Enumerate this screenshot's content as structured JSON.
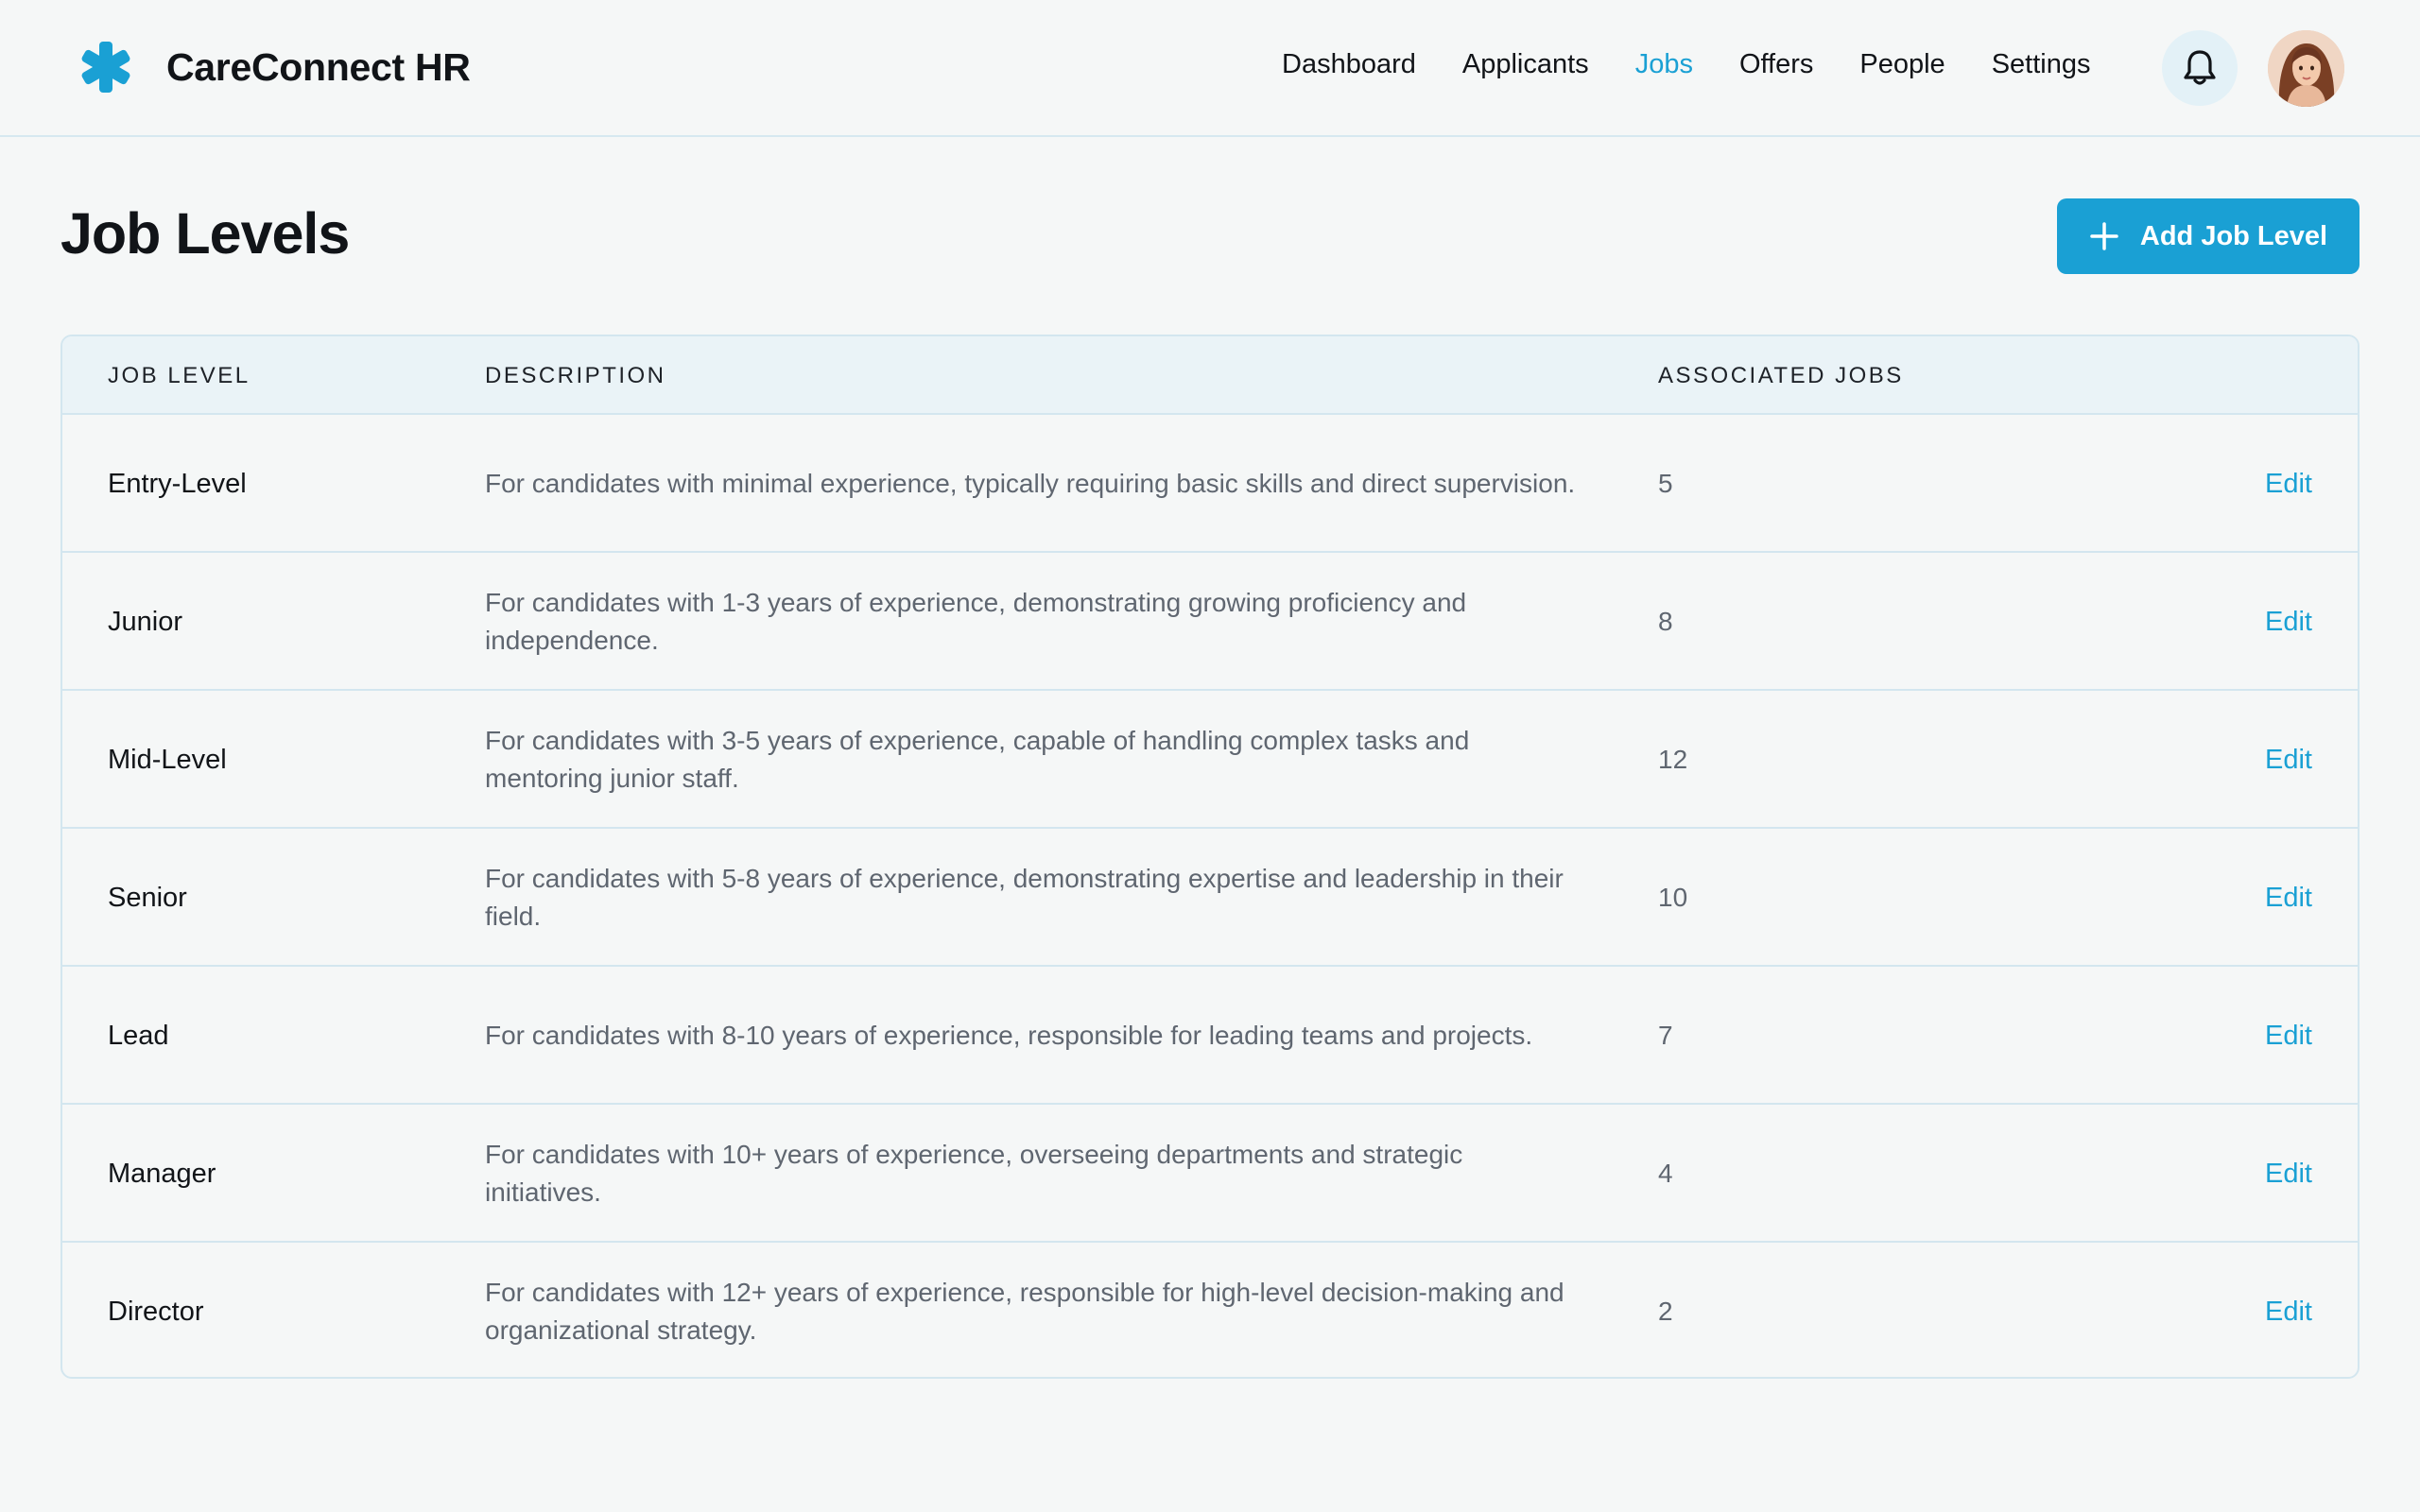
{
  "app": {
    "name": "CareConnect HR",
    "logo_icon": "asterisk-icon",
    "accent_color": "#1aa0d4"
  },
  "nav": {
    "items": [
      {
        "label": "Dashboard",
        "active": false
      },
      {
        "label": "Applicants",
        "active": false
      },
      {
        "label": "Jobs",
        "active": true
      },
      {
        "label": "Offers",
        "active": false
      },
      {
        "label": "People",
        "active": false
      },
      {
        "label": "Settings",
        "active": false
      }
    ],
    "notification_icon": "bell-icon",
    "avatar_icon": "user-avatar"
  },
  "page": {
    "title": "Job Levels",
    "add_button_label": "Add Job Level",
    "add_button_icon": "plus-icon"
  },
  "table": {
    "headers": {
      "level": "JOB LEVEL",
      "description": "DESCRIPTION",
      "associated": "ASSOCIATED JOBS"
    },
    "rows": [
      {
        "level": "Entry-Level",
        "description": "For candidates with minimal experience, typically requiring basic skills and direct supervision.",
        "count": "5",
        "action": "Edit"
      },
      {
        "level": "Junior",
        "description": "For candidates with 1-3 years of experience, demonstrating growing proficiency and independence.",
        "count": "8",
        "action": "Edit"
      },
      {
        "level": "Mid-Level",
        "description": "For candidates with 3-5 years of experience, capable of handling complex tasks and mentoring junior staff.",
        "count": "12",
        "action": "Edit"
      },
      {
        "level": "Senior",
        "description": "For candidates with 5-8 years of experience, demonstrating expertise and leadership in their field.",
        "count": "10",
        "action": "Edit"
      },
      {
        "level": "Lead",
        "description": "For candidates with 8-10 years of experience, responsible for leading teams and projects.",
        "count": "7",
        "action": "Edit"
      },
      {
        "level": "Manager",
        "description": "For candidates with 10+ years of experience, overseeing departments and strategic initiatives.",
        "count": "4",
        "action": "Edit"
      },
      {
        "level": "Director",
        "description": "For candidates with 12+ years of experience, responsible for high-level decision-making and organizational strategy.",
        "count": "2",
        "action": "Edit"
      }
    ]
  }
}
